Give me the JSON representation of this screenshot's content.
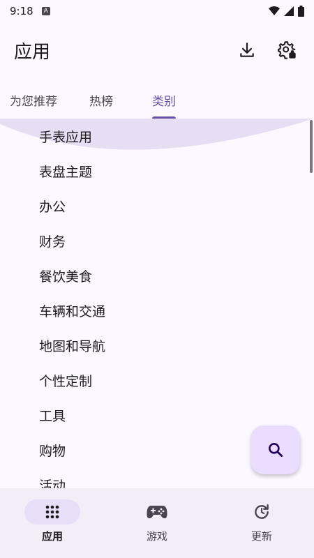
{
  "status_bar": {
    "time": "9:18",
    "notification_icon": "A"
  },
  "app_bar": {
    "title": "应用",
    "actions": [
      "download-icon",
      "settings-account-icon"
    ]
  },
  "tabs": [
    {
      "label": "为您推荐",
      "active": false
    },
    {
      "label": "热榜",
      "active": false
    },
    {
      "label": "类别",
      "active": true
    }
  ],
  "categories": [
    "手表应用",
    "表盘主题",
    "办公",
    "财务",
    "餐饮美食",
    "车辆和交通",
    "地图和导航",
    "个性定制",
    "工具",
    "购物",
    "活动"
  ],
  "fab": {
    "icon": "search-icon"
  },
  "bottom_nav": [
    {
      "label": "应用",
      "icon": "apps-grid-icon",
      "active": true
    },
    {
      "label": "游戏",
      "icon": "gamepad-icon",
      "active": false
    },
    {
      "label": "更新",
      "icon": "update-icon",
      "active": false
    }
  ],
  "colors": {
    "background": "#fdf7ff",
    "accent": "#6750a4",
    "fab": "#eaddff",
    "nav_background": "#f3edf7",
    "nav_active_pill": "#e8def8"
  }
}
